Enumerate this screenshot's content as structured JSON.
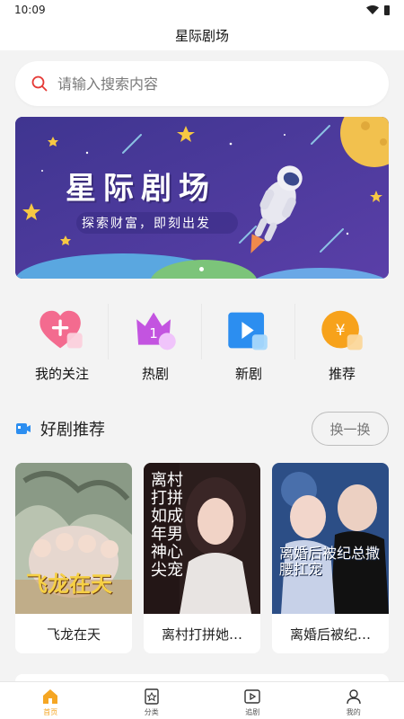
{
  "status_bar": {
    "time": "10:09"
  },
  "header": {
    "title": "星际剧场"
  },
  "search": {
    "placeholder": "请输入搜索内容"
  },
  "banner": {
    "title": "星际剧场",
    "subtitle": "探索财富，即刻出发"
  },
  "quick_nav": [
    {
      "label": "我的关注",
      "icon": "heart-plus-icon"
    },
    {
      "label": "热剧",
      "icon": "crown-rank-icon"
    },
    {
      "label": "新剧",
      "icon": "play-video-icon"
    },
    {
      "label": "推荐",
      "icon": "yuan-coin-icon"
    }
  ],
  "section": {
    "title": "好剧推荐",
    "refresh_label": "换一换"
  },
  "dramas": [
    {
      "title": "飞龙在天",
      "poster_text": "飞龙在天"
    },
    {
      "title": "离村打拼她…",
      "poster_text": "离村打拼 如成年男神心尖宠"
    },
    {
      "title": "离婚后被纪…",
      "poster_text": "离婚后被纪总撒腰扛宠"
    }
  ],
  "tabs": [
    {
      "label": "首页",
      "icon": "home-icon",
      "active": true
    },
    {
      "label": "分类",
      "icon": "category-icon",
      "active": false
    },
    {
      "label": "追剧",
      "icon": "play-list-icon",
      "active": false
    },
    {
      "label": "我的",
      "icon": "user-icon",
      "active": false
    }
  ],
  "colors": {
    "accent": "#f5a623",
    "banner_bg": "#4b3a9a",
    "search_icon": "#e53935"
  }
}
